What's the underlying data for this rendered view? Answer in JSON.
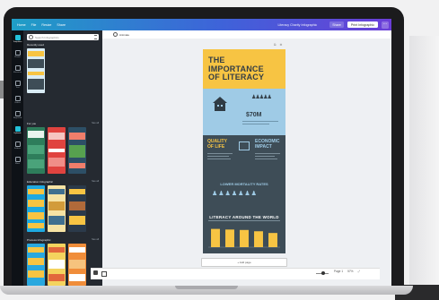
{
  "topbar": {
    "menu": [
      "Home",
      "File",
      "Resize",
      "Share"
    ],
    "doc_title": "Literacy Charity Infographic",
    "share_label": "Share",
    "publish_label": "Print Infographic",
    "more_label": "···"
  },
  "rail": {
    "items": [
      "Templates",
      "Photos",
      "Elements",
      "Text",
      "Videos",
      "Bkground",
      "Uploads",
      "Folders",
      "More"
    ]
  },
  "panel": {
    "search_placeholder": "Search Infographics",
    "sections": [
      {
        "title": "Recently used",
        "see_all": ""
      },
      {
        "title": "For you",
        "see_all": "See all"
      },
      {
        "title": "Education Infographic",
        "see_all": "See all"
      },
      {
        "title": "Process Infographic",
        "see_all": "See all"
      }
    ],
    "collapse_icon": "‹"
  },
  "canvas": {
    "animate_label": "Animate",
    "page_tool_1": "⧉",
    "page_tool_2": "⊕",
    "add_page_label": "+ Add page"
  },
  "infographic": {
    "title_line1": "THE IMPORTANCE",
    "title_line2": "OF LITERACY",
    "people_icons": "♟♟♟♟♟",
    "stat_amount": "$70M",
    "quality_line1": "QUALITY",
    "quality_line2": "OF LIFE",
    "economic_line1": "ECONOMIC",
    "economic_line2": "IMPACT",
    "mortality_heading": "LOWER MORTALITY RATES",
    "figures": "♟♟♟♟♟♟♟",
    "world_heading": "LITERACY AROUND THE WORLD",
    "colors": {
      "yellow": "#f7c443",
      "blue": "#9fcbe6",
      "slate": "#3e4d57"
    }
  },
  "chart_data": {
    "type": "bar",
    "categories": [
      "",
      "",
      "",
      "",
      ""
    ],
    "values": [
      85,
      82,
      80,
      74,
      66
    ],
    "ylim": [
      0,
      100
    ],
    "color": "#f7c443"
  },
  "bottom": {
    "page_label": "Page 1",
    "zoom_label": "57%",
    "fullscreen_icon": "⤢"
  }
}
